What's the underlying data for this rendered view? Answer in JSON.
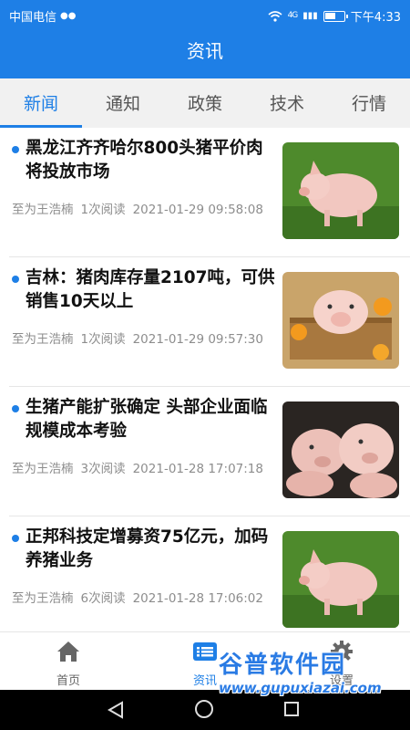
{
  "status_bar": {
    "carrier": "中国电信",
    "signal": "4G",
    "battery_level": 0.6,
    "time": "下午4:33"
  },
  "header": {
    "title": "资讯"
  },
  "tabs": [
    {
      "label": "新闻",
      "active": true
    },
    {
      "label": "通知",
      "active": false
    },
    {
      "label": "政策",
      "active": false
    },
    {
      "label": "技术",
      "active": false
    },
    {
      "label": "行情",
      "active": false
    }
  ],
  "news": [
    {
      "title": "黑龙江齐齐哈尔800头猪平价肉将投放市场",
      "author": "至为王浩楠",
      "reads": "1次阅读",
      "time": "2021-01-29 09:58:08",
      "image": "piglet-on-grass"
    },
    {
      "title": "吉林：猪肉库存量2107吨，可供销售10天以上",
      "author": "至为王浩楠",
      "reads": "1次阅读",
      "time": "2021-01-29 09:57:30",
      "image": "piglet-in-basket"
    },
    {
      "title": "生猪产能扩张确定 头部企业面临规模成本考验",
      "author": "至为王浩楠",
      "reads": "3次阅读",
      "time": "2021-01-28 17:07:18",
      "image": "pigs-group"
    },
    {
      "title": "正邦科技定增募资75亿元，加码养猪业务",
      "author": "至为王浩楠",
      "reads": "6次阅读",
      "time": "2021-01-28 17:06:02",
      "image": "piglet-on-grass"
    }
  ],
  "bottom_nav": [
    {
      "label": "首页",
      "icon": "home-icon",
      "active": false
    },
    {
      "label": "资讯",
      "icon": "news-icon",
      "active": true
    },
    {
      "label": "设置",
      "icon": "gear-icon",
      "active": false
    }
  ],
  "watermark": {
    "logo": "谷普软件园",
    "url": "www.gupuxiazai.com"
  },
  "colors": {
    "primary": "#1e7fe6",
    "tab_bg": "#f1f1f1",
    "meta_text": "#8d8d8d"
  }
}
